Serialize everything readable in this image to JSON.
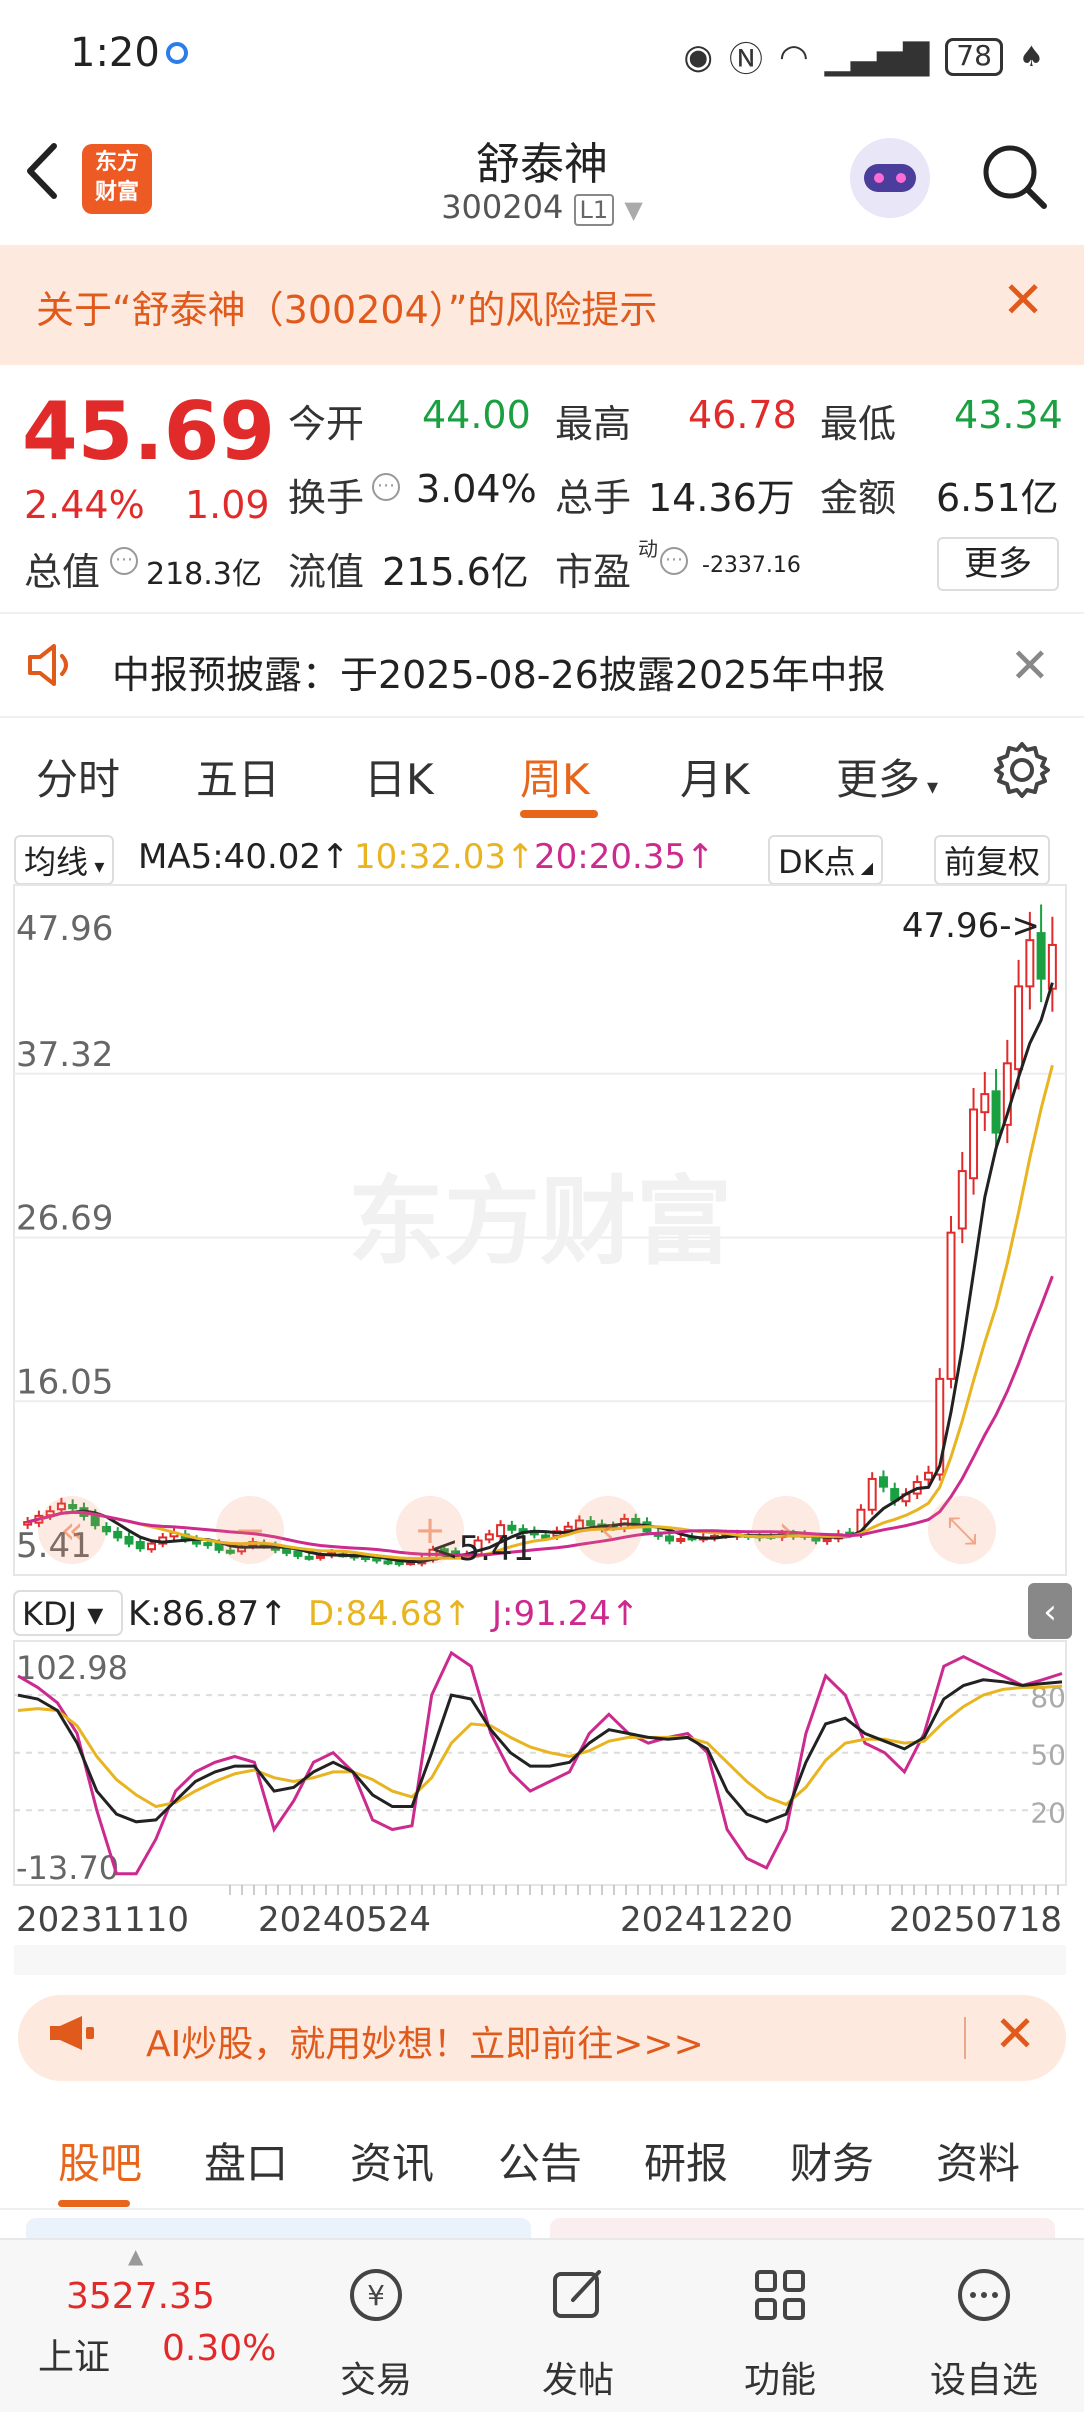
{
  "status_bar": {
    "time": "1:20",
    "battery": "78"
  },
  "header": {
    "back_icon": "chevron-left-icon",
    "logo_text": "东方\n财富",
    "stock_name": "舒泰神",
    "stock_code": "300204",
    "level": "L1"
  },
  "risk_notice": {
    "text": "关于“舒泰神（300204）”的风险提示"
  },
  "quote": {
    "price": "45.69",
    "change_pct": "2.44%",
    "change_amt": "1.09",
    "open_label": "今开",
    "open": "44.00",
    "high_label": "最高",
    "high": "46.78",
    "low_label": "最低",
    "low": "43.34",
    "turnover_label": "换手",
    "turnover": "3.04%",
    "volume_label": "总手",
    "volume": "14.36万",
    "amount_label": "金额",
    "amount": "6.51亿",
    "mktcap_label": "总值",
    "mktcap": "218.3亿",
    "float_label": "流值",
    "float": "215.6亿",
    "pe_label": "市盈",
    "pe_sup": "动",
    "pe": "-2337.16",
    "more_label": "更多"
  },
  "disclosure": {
    "text": "中报预披露：于2025-08-26披露2025年中报"
  },
  "tabs": [
    "分时",
    "五日",
    "日K",
    "周K",
    "月K",
    "更多"
  ],
  "active_tab": "周K",
  "ma_bar": {
    "selector": "均线",
    "ma5": "MA5:40.02",
    "ma10": "10:32.03",
    "ma20": "20:20.35",
    "dk": "DK点",
    "adjust": "前复权"
  },
  "kdj_bar": {
    "selector": "KDJ",
    "k": "K:86.87",
    "d": "D:84.68",
    "j": "J:91.24"
  },
  "colors": {
    "up": "#e12b2b",
    "down": "#1aa040",
    "accent": "#e8661c",
    "ma5": "#222222",
    "ma10": "#e8b420",
    "ma20": "#cc2a8f"
  },
  "chart_data": {
    "type": "candlestick",
    "price_axis_labels": [
      "47.96",
      "37.32",
      "26.69",
      "16.05",
      "5.41"
    ],
    "ylim": [
      5.41,
      47.96
    ],
    "max_marker": "47.96->",
    "min_marker": "<5.41",
    "watermark": "东方财富",
    "date_labels": [
      "20231110",
      "20240524",
      "20241220",
      "20250718"
    ],
    "close": [
      8.2,
      8.6,
      8.9,
      9.4,
      9.1,
      8.6,
      8.0,
      7.6,
      7.2,
      6.8,
      6.5,
      6.8,
      7.2,
      7.5,
      7.1,
      6.8,
      6.7,
      6.4,
      6.3,
      6.6,
      6.9,
      6.7,
      6.4,
      6.2,
      6.0,
      5.9,
      6.0,
      6.2,
      6.1,
      5.9,
      5.8,
      5.7,
      5.6,
      5.5,
      5.6,
      5.8,
      6.4,
      6.2,
      6.0,
      6.1,
      7.0,
      7.4,
      8.0,
      7.7,
      7.5,
      7.4,
      7.3,
      7.6,
      7.9,
      8.3,
      8.0,
      7.8,
      7.9,
      8.4,
      8.1,
      7.6,
      7.3,
      7.0,
      7.1,
      7.2,
      7.2,
      7.3,
      7.4,
      7.4,
      7.3,
      7.2,
      7.3,
      7.4,
      7.3,
      7.3,
      7.0,
      7.1,
      7.4,
      7.5,
      9.0,
      11.0,
      10.5,
      9.6,
      10.0,
      10.8,
      11.4,
      17.5,
      27.0,
      31.0,
      35.0,
      36.0,
      33.5,
      38.0,
      43.0,
      46.0,
      43.5,
      45.69
    ],
    "volume_note": "",
    "kdj_axis_labels": [
      "102.98",
      "80",
      "50",
      "20",
      "-13.70"
    ],
    "kdj_ylim": [
      -13.7,
      102.98
    ],
    "j": [
      90,
      84,
      76,
      60,
      20,
      -13,
      -13,
      5,
      30,
      40,
      45,
      48,
      45,
      10,
      25,
      45,
      50,
      40,
      15,
      10,
      12,
      80,
      102,
      95,
      60,
      40,
      30,
      35,
      40,
      60,
      70,
      60,
      55,
      58,
      60,
      50,
      10,
      -5,
      -10,
      10,
      60,
      90,
      80,
      55,
      50,
      40,
      60,
      95,
      100,
      95,
      90,
      85,
      88,
      91.24
    ],
    "k": [
      80,
      78,
      72,
      55,
      30,
      18,
      14,
      15,
      25,
      35,
      40,
      43,
      43,
      30,
      32,
      40,
      45,
      40,
      28,
      22,
      22,
      50,
      80,
      78,
      62,
      50,
      43,
      43,
      45,
      55,
      62,
      60,
      58,
      57,
      58,
      52,
      30,
      18,
      14,
      18,
      45,
      65,
      68,
      60,
      56,
      52,
      58,
      78,
      85,
      88,
      87,
      85,
      86,
      86.87
    ],
    "d": [
      72,
      73,
      72,
      64,
      48,
      36,
      28,
      22,
      24,
      30,
      35,
      39,
      41,
      37,
      35,
      37,
      40,
      40,
      36,
      30,
      27,
      37,
      55,
      65,
      64,
      58,
      53,
      50,
      48,
      51,
      56,
      58,
      58,
      58,
      58,
      55,
      45,
      35,
      27,
      23,
      32,
      46,
      55,
      57,
      57,
      55,
      56,
      66,
      74,
      80,
      83,
      84,
      84,
      84.68
    ]
  },
  "ai_banner": {
    "text": "AI炒股，就用妙想！立即前往>>>"
  },
  "sub_tabs": [
    "股吧",
    "盘口",
    "资讯",
    "公告",
    "研报",
    "财务",
    "资料"
  ],
  "bottom_nav": {
    "index_value": "3527.35",
    "index_name": "上证",
    "index_pct": "0.30%",
    "items": [
      {
        "label": "交易",
        "icon": "yen-trade-icon"
      },
      {
        "label": "发帖",
        "icon": "edit-post-icon"
      },
      {
        "label": "功能",
        "icon": "grid-apps-icon"
      },
      {
        "label": "设自选",
        "icon": "more-dots-icon"
      }
    ]
  }
}
